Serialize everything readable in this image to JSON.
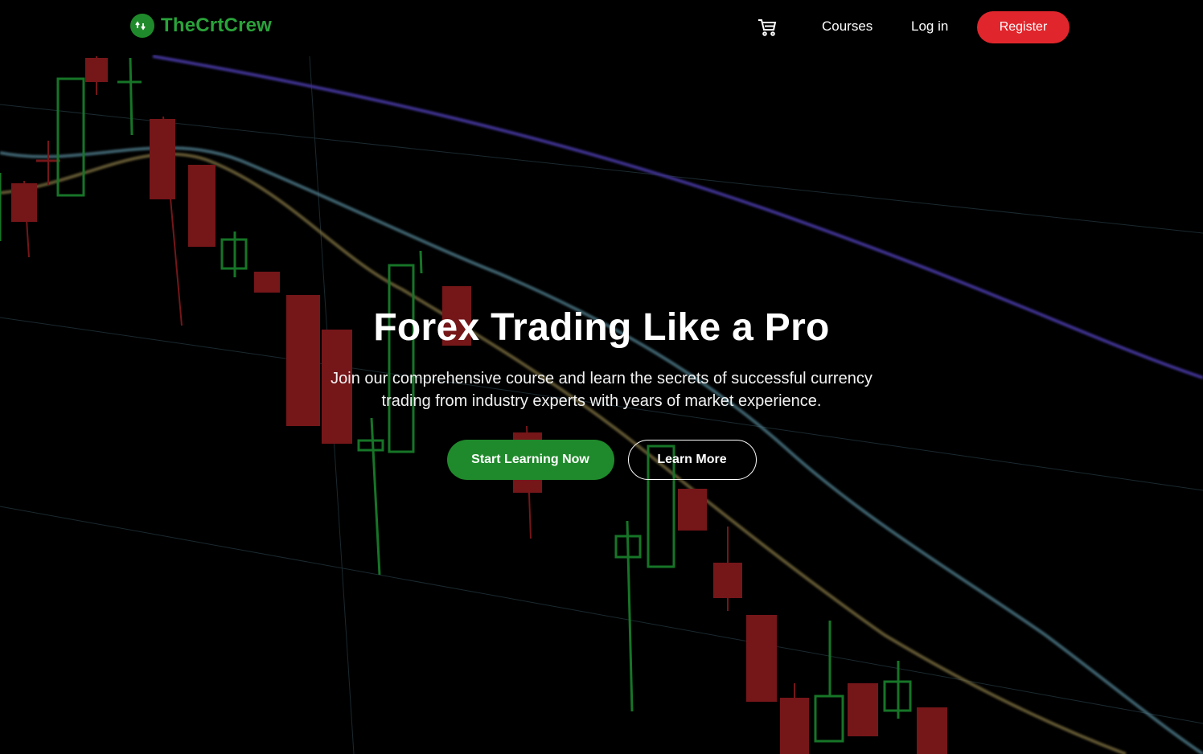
{
  "brand": {
    "name": "TheCrtCrew",
    "icon": "trend-arrows-icon",
    "color": "#1f8a2b"
  },
  "nav": {
    "cart_icon": "cart-icon",
    "courses": "Courses",
    "login": "Log in",
    "register": "Register",
    "register_color": "#e0262c"
  },
  "hero": {
    "title": "Forex Trading Like a Pro",
    "subtitle": "Join our comprehensive course and learn the secrets of successful currency trading from industry experts with years of market experience.",
    "primary_button": "Start Learning Now",
    "secondary_button": "Learn More"
  },
  "background": {
    "description_icon": "candlestick-chart-icon"
  }
}
